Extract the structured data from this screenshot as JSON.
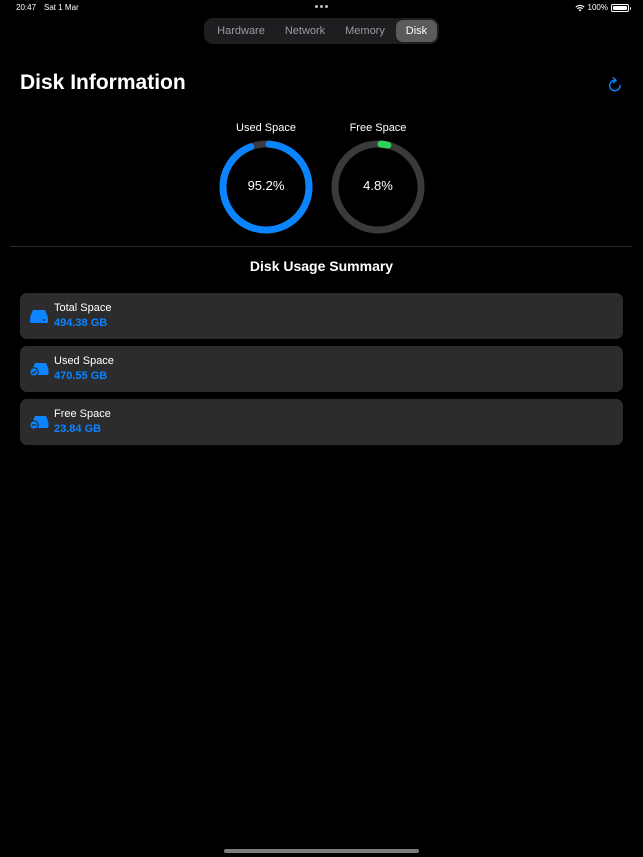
{
  "status_bar": {
    "time": "20:47",
    "date": "Sat 1 Mar",
    "battery": "100%"
  },
  "tabs": [
    {
      "label": "Hardware",
      "active": false
    },
    {
      "label": "Network",
      "active": false
    },
    {
      "label": "Memory",
      "active": false
    },
    {
      "label": "Disk",
      "active": true
    }
  ],
  "header": {
    "title": "Disk Information",
    "refresh_icon": "arrow-clockwise-icon"
  },
  "gauges": {
    "used": {
      "label": "Used Space",
      "value_text": "95.2%",
      "fraction": 0.952,
      "color": "#0a84ff"
    },
    "free": {
      "label": "Free Space",
      "value_text": "4.8%",
      "fraction": 0.048,
      "color": "#30d158"
    }
  },
  "summary": {
    "title": "Disk Usage Summary",
    "items": [
      {
        "label": "Total Space",
        "value": "494.38 GB",
        "icon": "internal-drive-icon"
      },
      {
        "label": "Used Space",
        "value": "470.55 GB",
        "icon": "drive-checkmark-icon"
      },
      {
        "label": "Free Space",
        "value": "23.84 GB",
        "icon": "drive-minus-icon"
      }
    ]
  },
  "colors": {
    "accent": "#0a84ff",
    "free_green": "#30d158",
    "card_background": "#2c2c2e",
    "background": "#000000"
  }
}
